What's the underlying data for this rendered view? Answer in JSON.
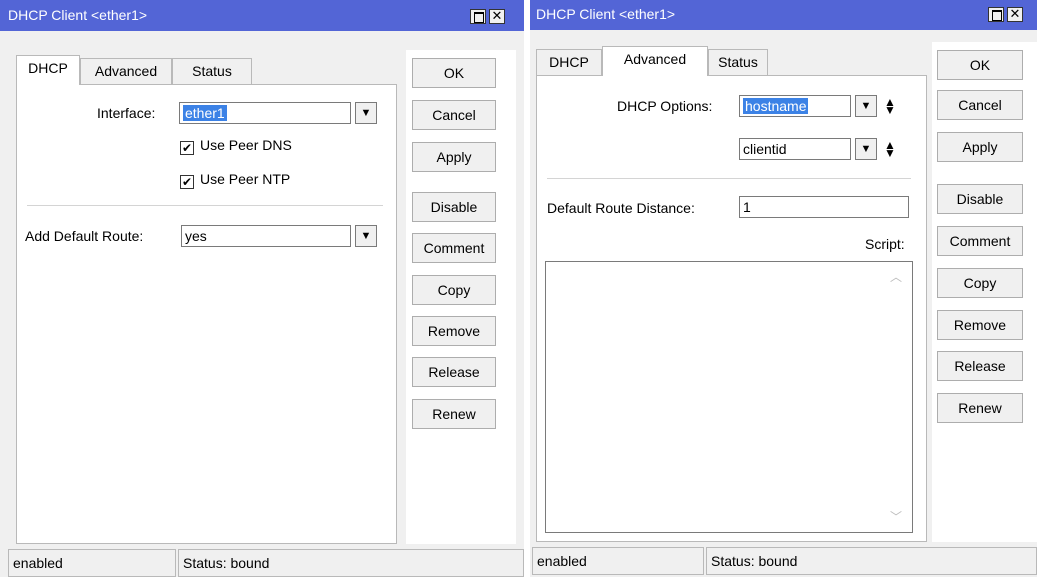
{
  "left_window": {
    "title": "DHCP Client <ether1>",
    "tabs": [
      "DHCP",
      "Advanced",
      "Status"
    ],
    "active_tab": "DHCP",
    "interface_label": "Interface:",
    "interface_value": "ether1",
    "use_peer_dns_label": "Use Peer DNS",
    "use_peer_ntp_label": "Use Peer NTP",
    "add_default_route_label": "Add Default Route:",
    "add_default_route_value": "yes",
    "buttons": [
      "OK",
      "Cancel",
      "Apply",
      "Disable",
      "Comment",
      "Copy",
      "Remove",
      "Release",
      "Renew"
    ],
    "status_left": "enabled",
    "status_right": "Status: bound"
  },
  "right_window": {
    "title": "DHCP Client <ether1>",
    "tabs": [
      "DHCP",
      "Advanced",
      "Status"
    ],
    "active_tab": "Advanced",
    "dhcp_options_label": "DHCP Options:",
    "dhcp_option_1": "hostname",
    "dhcp_option_2": "clientid",
    "default_route_distance_label": "Default Route Distance:",
    "default_route_distance_value": "1",
    "script_label": "Script:",
    "script_value": "",
    "buttons": [
      "OK",
      "Cancel",
      "Apply",
      "Disable",
      "Comment",
      "Copy",
      "Remove",
      "Release",
      "Renew"
    ],
    "status_left": "enabled",
    "status_right": "Status: bound"
  },
  "icons": {
    "maximize": "maximize-icon",
    "close": "close-icon",
    "dropdown": "dropdown-arrow-icon",
    "updown": "up-down-arrows-icon",
    "check": "checkmark-icon"
  },
  "colors": {
    "titlebar": "#5365d6",
    "selection": "#3c82e6"
  }
}
